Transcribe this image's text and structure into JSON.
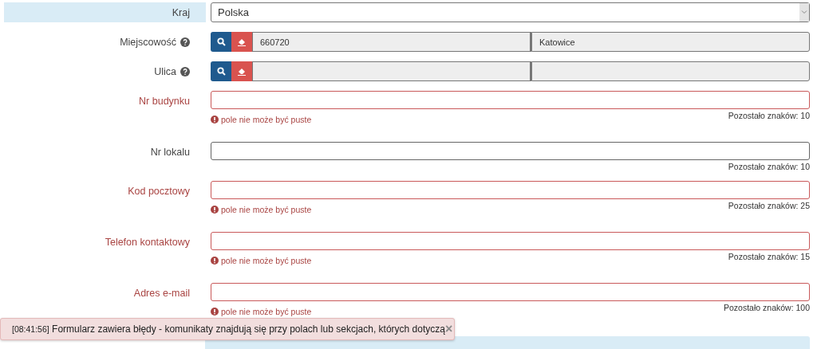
{
  "fields": [
    {
      "kind": "select",
      "label": "Kraj",
      "value": "Polska",
      "highlighted": true
    },
    {
      "kind": "lookup",
      "label": "Miejscowość",
      "help": true,
      "values": [
        "660720",
        "Katowice"
      ]
    },
    {
      "kind": "lookup",
      "label": "Ulica",
      "help": true
    },
    {
      "kind": "text",
      "label": "Nr budynku",
      "invalid": true,
      "error": "pole nie może być puste",
      "counter": "Pozostało znaków: 10"
    },
    {
      "kind": "text",
      "label": "Nr lokalu",
      "invalid": false,
      "counter": "Pozostało znaków: 10"
    },
    {
      "kind": "text",
      "label": "Kod pocztowy",
      "invalid": true,
      "error": "pole nie może być puste",
      "counter": "Pozostało znaków: 25"
    },
    {
      "kind": "text",
      "label": "Telefon kontaktowy",
      "invalid": true,
      "error": "pole nie może być puste",
      "counter": "Pozostało znaków: 15"
    },
    {
      "kind": "text",
      "label": "Adres e-mail",
      "invalid": true,
      "error": "pole nie może być puste",
      "counter": "Pozostało znaków: 100"
    }
  ],
  "toast": {
    "time": "[08:41:56]",
    "message": "Formularz zawiera błędy - komunikaty znajdują się przy polach lub sekcjach, których dotyczą",
    "close": "×"
  }
}
